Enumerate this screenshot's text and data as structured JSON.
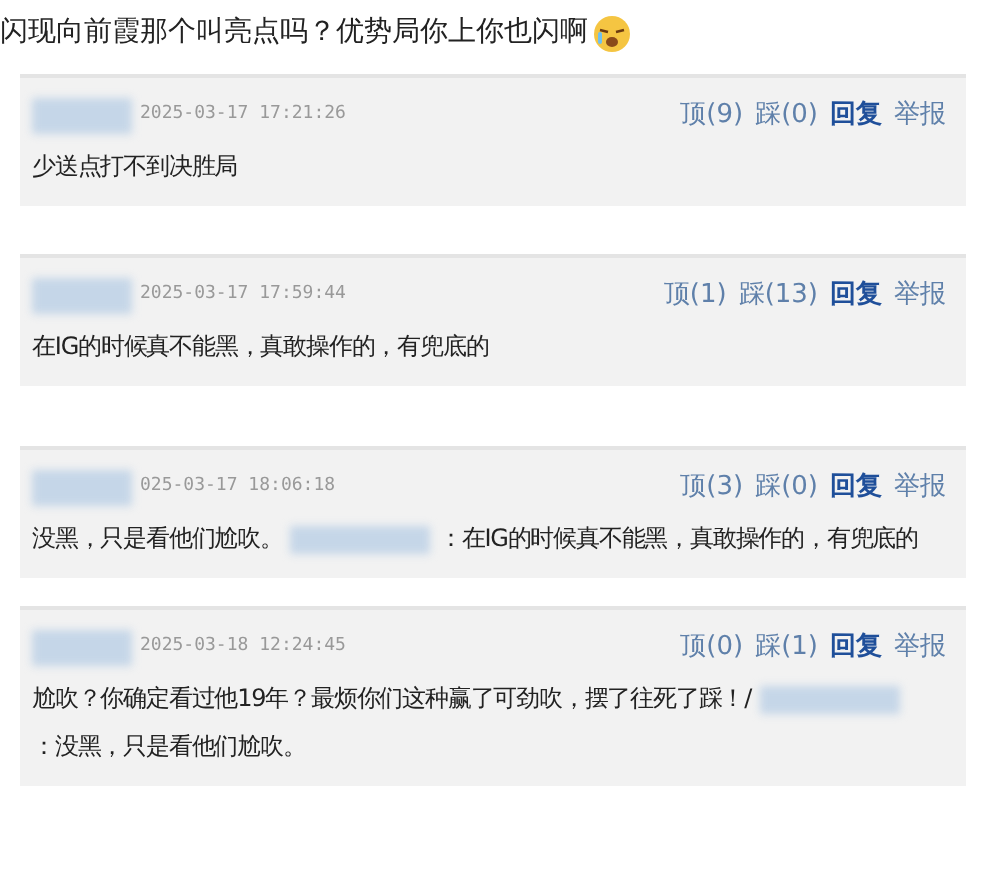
{
  "post": {
    "text": "闪现向前霞那个叫亮点吗？优势局你上你也闪啊"
  },
  "comments": [
    {
      "time": "2025-03-17 17:21:26",
      "up": "顶(9)",
      "down": "踩(0)",
      "reply": "回复",
      "report": "举报",
      "body": [
        {
          "kind": "text",
          "text": "少送点打不到决胜局"
        }
      ]
    },
    {
      "time": "2025-03-17 17:59:44",
      "up": "顶(1)",
      "down": "踩(13)",
      "reply": "回复",
      "report": "举报",
      "body": [
        {
          "kind": "text",
          "text": "在IG的时候真不能黑，真敢操作的，有兜底的"
        }
      ]
    },
    {
      "time": "025-03-17 18:06:18",
      "up": "顶(3)",
      "down": "踩(0)",
      "reply": "回复",
      "report": "举报",
      "body": [
        {
          "kind": "text",
          "text": "没黑，只是看他们尬吹。"
        },
        {
          "kind": "redacted"
        },
        {
          "kind": "text",
          "text": "：在IG的时候真不能黑，真敢操作的，有兜底的"
        }
      ]
    },
    {
      "time": "2025-03-18 12:24:45",
      "up": "顶(0)",
      "down": "踩(1)",
      "reply": "回复",
      "report": "举报",
      "body": [
        {
          "kind": "text",
          "text": "尬吹？你确定看过他19年？最烦你们这种赢了可劲吹，摆了往死了踩！/"
        },
        {
          "kind": "redacted"
        },
        {
          "kind": "text",
          "text": "：没黑，只是"
        },
        {
          "kind": "text",
          "text": "看他们尬吹。"
        }
      ]
    }
  ]
}
